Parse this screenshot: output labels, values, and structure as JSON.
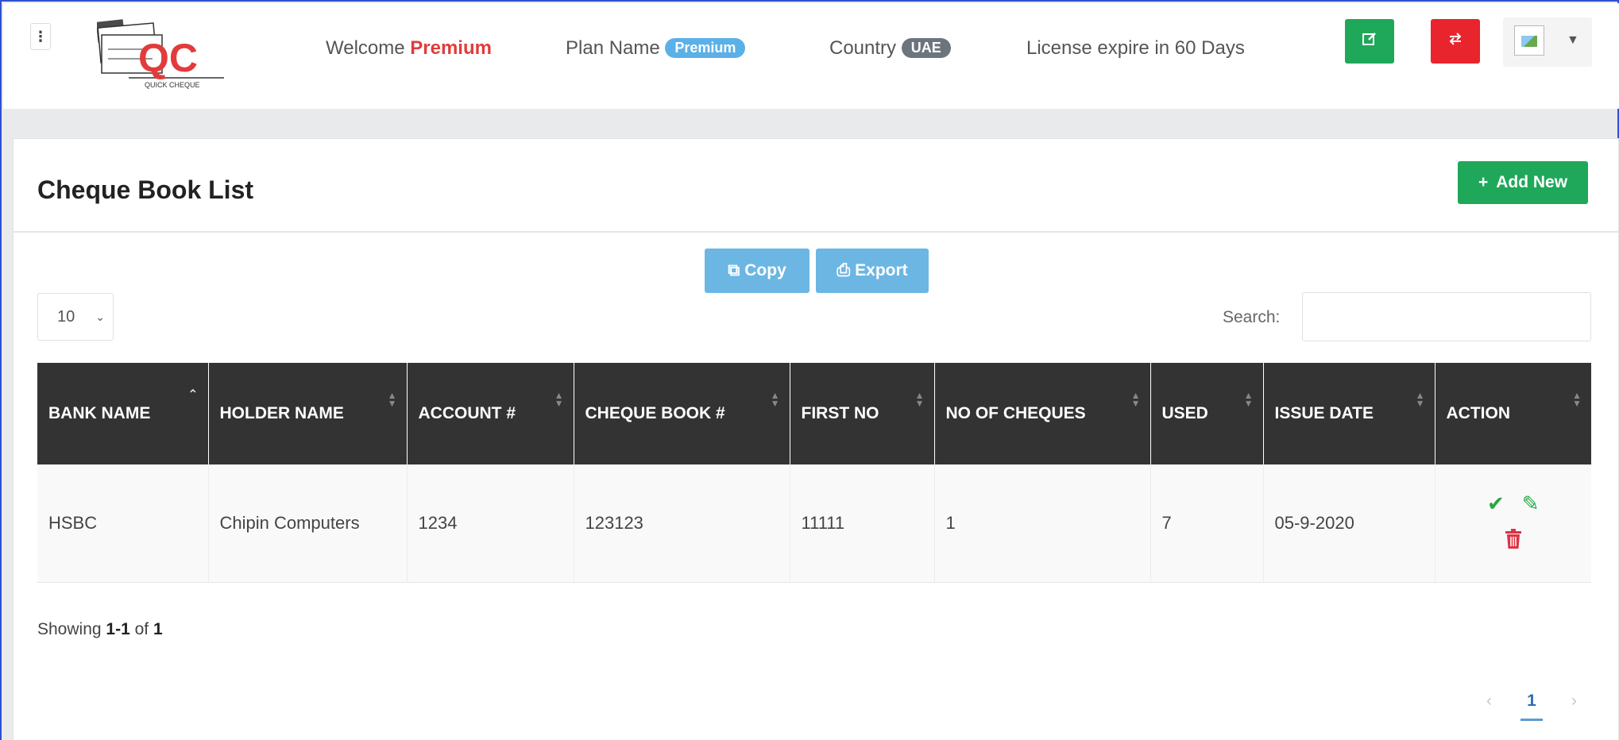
{
  "header": {
    "menu_glyph": "⋮",
    "logo_text": "QC",
    "logo_subtext": "QUICK CHEQUE",
    "welcome_label": "Welcome",
    "welcome_name": "Premium",
    "plan_label": "Plan Name",
    "plan_value": "Premium",
    "country_label": "Country",
    "country_value": "UAE",
    "license_text": "License expire in 60 Days",
    "edit_icon": "edit-icon",
    "switch_icon": "switch-icon"
  },
  "page": {
    "title": "Cheque Book List",
    "add_new_label": "Add New"
  },
  "toolbar": {
    "copy_label": "Copy",
    "export_label": "Export",
    "page_size": "10",
    "search_label": "Search:",
    "search_value": ""
  },
  "table": {
    "columns": [
      "BANK NAME",
      "HOLDER NAME",
      "ACCOUNT #",
      "CHEQUE BOOK #",
      "FIRST NO",
      "NO OF CHEQUES",
      "USED",
      "ISSUE DATE",
      "ACTION"
    ],
    "rows": [
      {
        "bank_name": "HSBC",
        "holder_name": "Chipin Computers",
        "account": "1234",
        "cheque_book": "123123",
        "first_no": "11111",
        "no_of_cheques": "1",
        "used": "7",
        "issue_date": "05-9-2020"
      }
    ]
  },
  "footer": {
    "showing_prefix": "Showing",
    "showing_range": "1-1",
    "showing_of": "of",
    "showing_total": "1",
    "current_page": "1"
  },
  "colors": {
    "primary_green": "#1fa85a",
    "danger_red": "#e8242d",
    "info_blue": "#6cb6e4",
    "table_header": "#333333"
  }
}
